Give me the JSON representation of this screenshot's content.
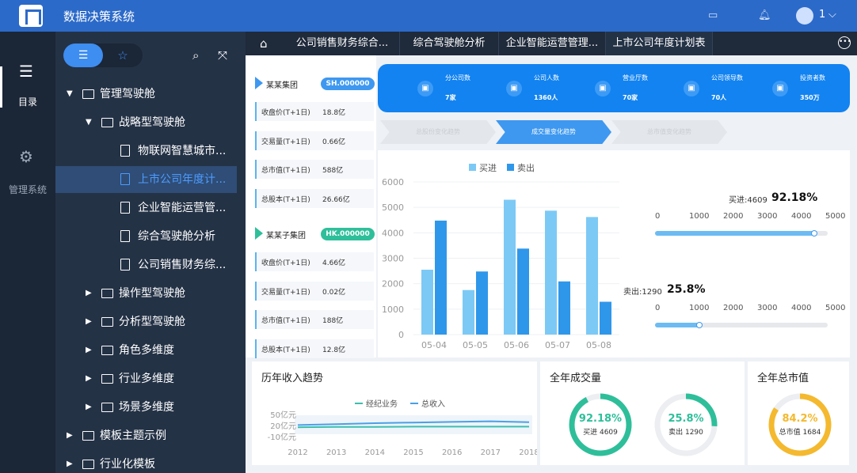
{
  "app": {
    "title": "数据决策系统",
    "user_count": "1"
  },
  "leftnav": [
    {
      "label": "目录",
      "icon": "list-icon"
    },
    {
      "label": "管理系统",
      "icon": "gear-icon"
    }
  ],
  "tree": [
    {
      "label": "管理驾驶舱",
      "kind": "folder",
      "depth": 0,
      "expanded": true
    },
    {
      "label": "战略型驾驶舱",
      "kind": "folder",
      "depth": 1,
      "expanded": true
    },
    {
      "label": "物联网智慧城市...",
      "kind": "doc",
      "depth": 2
    },
    {
      "label": "上市公司年度计...",
      "kind": "doc",
      "depth": 2,
      "selected": true
    },
    {
      "label": "企业智能运营管...",
      "kind": "doc",
      "depth": 2
    },
    {
      "label": "综合驾驶舱分析",
      "kind": "doc",
      "depth": 2
    },
    {
      "label": "公司销售财务综...",
      "kind": "doc",
      "depth": 2
    },
    {
      "label": "操作型驾驶舱",
      "kind": "folder",
      "depth": 1
    },
    {
      "label": "分析型驾驶舱",
      "kind": "folder",
      "depth": 1
    },
    {
      "label": "角色多维度",
      "kind": "folder",
      "depth": 1
    },
    {
      "label": "行业多维度",
      "kind": "folder",
      "depth": 1
    },
    {
      "label": "场景多维度",
      "kind": "folder",
      "depth": 1
    },
    {
      "label": "模板主题示例",
      "kind": "folder",
      "depth": 0
    },
    {
      "label": "行业化模板",
      "kind": "folder",
      "depth": 0
    }
  ],
  "tabs": [
    "公司销售财务综合...",
    "综合驾驶舱分析",
    "企业智能运营管理...",
    "上市公司年度计划表"
  ],
  "active_tab": 3,
  "groups": [
    {
      "name": "某某集团",
      "code": "SH.000000",
      "color": "#3e98f0",
      "metrics": [
        {
          "label": "收盘价(T+1日)",
          "value": "18.8亿"
        },
        {
          "label": "交易量(T+1日)",
          "value": "0.66亿"
        },
        {
          "label": "总市值(T+1日)",
          "value": "588亿"
        },
        {
          "label": "总股本(T+1日)",
          "value": "26.66亿"
        }
      ]
    },
    {
      "name": "某某子集团",
      "code": "HK.000000",
      "color": "#2ebf9a",
      "metrics": [
        {
          "label": "收盘价(T+1日)",
          "value": "4.66亿"
        },
        {
          "label": "交易量(T+1日)",
          "value": "0.02亿"
        },
        {
          "label": "总市值(T+1日)",
          "value": "188亿"
        },
        {
          "label": "总股本(T+1日)",
          "value": "12.8亿"
        }
      ]
    }
  ],
  "kpis": [
    {
      "label": "分公司数",
      "value": "7家",
      "icon": "building-icon"
    },
    {
      "label": "公司人数",
      "value": "1360人",
      "icon": "people-icon"
    },
    {
      "label": "营业厅数",
      "value": "70家",
      "icon": "store-icon"
    },
    {
      "label": "公司领导数",
      "value": "70人",
      "icon": "clipboard-icon"
    },
    {
      "label": "投资者数",
      "value": "350万",
      "icon": "investor-icon"
    }
  ],
  "steps": [
    {
      "label": "总股份变化趋势",
      "active": false
    },
    {
      "label": "成交量变化趋势",
      "active": true
    },
    {
      "label": "总市值变化趋势",
      "active": false
    }
  ],
  "chart_data": [
    {
      "type": "bar",
      "categories": [
        "05-04",
        "05-05",
        "05-06",
        "05-07",
        "05-08"
      ],
      "series": [
        {
          "name": "买进",
          "values": [
            2550,
            1750,
            5300,
            4870,
            4620
          ],
          "color": "#7cc9f5"
        },
        {
          "name": "卖出",
          "values": [
            4480,
            2480,
            3380,
            2090,
            1290
          ],
          "color": "#2f97ea"
        }
      ],
      "ylim": [
        0,
        6000
      ],
      "yticks": [
        0,
        1000,
        2000,
        3000,
        4000,
        5000,
        6000
      ],
      "legend": "top"
    },
    {
      "type": "line",
      "title": "历年收入趋势",
      "x": [
        "2012",
        "2013",
        "2014",
        "2015",
        "2016",
        "2017",
        "2018"
      ],
      "series": [
        {
          "name": "经纪业务",
          "values": [
            12,
            13,
            13,
            14,
            14,
            14,
            14
          ],
          "color": "#3cbfae"
        },
        {
          "name": "总收入",
          "values": [
            19,
            22,
            25,
            27,
            29,
            31,
            28
          ],
          "color": "#4aa0e6"
        }
      ],
      "yticks": [
        "50亿元",
        "20亿元",
        "-10亿元"
      ],
      "legend": "top"
    }
  ],
  "progress": [
    {
      "prefix": "买进:4609",
      "percent_text": "92.18%",
      "value": 0.9218,
      "ticks": [
        "0",
        "1000",
        "2000",
        "3000",
        "4000",
        "5000"
      ]
    },
    {
      "prefix": "卖出:1290",
      "percent_text": "25.8%",
      "value": 0.258,
      "ticks": [
        "0",
        "1000",
        "2000",
        "3000",
        "4000",
        "5000"
      ]
    }
  ],
  "panels": {
    "trade": "全年成交量",
    "market": "全年总市值"
  },
  "donuts": [
    {
      "pct": "92.18%",
      "sub": "买进 4609",
      "value": 0.9218,
      "color": "#2ebf9a",
      "text_color": "#2ebf9a"
    },
    {
      "pct": "25.8%",
      "sub": "卖出 1290",
      "value": 0.258,
      "color": "#2ebf9a",
      "text_color": "#2ebf9a"
    },
    {
      "pct": "84.2%",
      "sub": "总市值 1684",
      "value": 0.842,
      "color": "#f4b92e",
      "text_color": "#f4b92e"
    }
  ]
}
